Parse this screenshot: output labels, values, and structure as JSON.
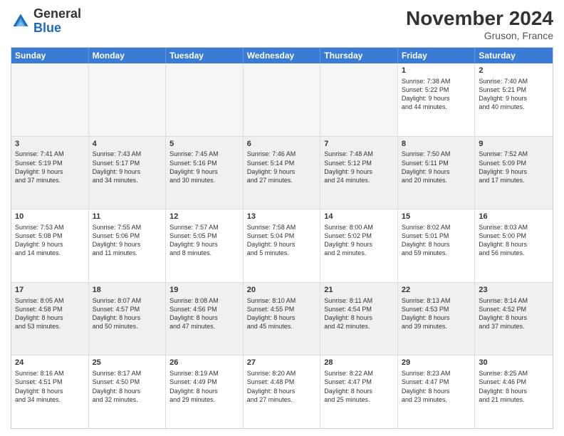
{
  "header": {
    "logo_line1": "General",
    "logo_line2": "Blue",
    "month_title": "November 2024",
    "location": "Gruson, France"
  },
  "weekdays": [
    "Sunday",
    "Monday",
    "Tuesday",
    "Wednesday",
    "Thursday",
    "Friday",
    "Saturday"
  ],
  "rows": [
    [
      {
        "day": "",
        "empty": true
      },
      {
        "day": "",
        "empty": true
      },
      {
        "day": "",
        "empty": true
      },
      {
        "day": "",
        "empty": true
      },
      {
        "day": "",
        "empty": true
      },
      {
        "day": "1",
        "lines": [
          "Sunrise: 7:38 AM",
          "Sunset: 5:22 PM",
          "Daylight: 9 hours",
          "and 44 minutes."
        ]
      },
      {
        "day": "2",
        "lines": [
          "Sunrise: 7:40 AM",
          "Sunset: 5:21 PM",
          "Daylight: 9 hours",
          "and 40 minutes."
        ]
      }
    ],
    [
      {
        "day": "3",
        "lines": [
          "Sunrise: 7:41 AM",
          "Sunset: 5:19 PM",
          "Daylight: 9 hours",
          "and 37 minutes."
        ]
      },
      {
        "day": "4",
        "lines": [
          "Sunrise: 7:43 AM",
          "Sunset: 5:17 PM",
          "Daylight: 9 hours",
          "and 34 minutes."
        ]
      },
      {
        "day": "5",
        "lines": [
          "Sunrise: 7:45 AM",
          "Sunset: 5:16 PM",
          "Daylight: 9 hours",
          "and 30 minutes."
        ]
      },
      {
        "day": "6",
        "lines": [
          "Sunrise: 7:46 AM",
          "Sunset: 5:14 PM",
          "Daylight: 9 hours",
          "and 27 minutes."
        ]
      },
      {
        "day": "7",
        "lines": [
          "Sunrise: 7:48 AM",
          "Sunset: 5:12 PM",
          "Daylight: 9 hours",
          "and 24 minutes."
        ]
      },
      {
        "day": "8",
        "lines": [
          "Sunrise: 7:50 AM",
          "Sunset: 5:11 PM",
          "Daylight: 9 hours",
          "and 20 minutes."
        ]
      },
      {
        "day": "9",
        "lines": [
          "Sunrise: 7:52 AM",
          "Sunset: 5:09 PM",
          "Daylight: 9 hours",
          "and 17 minutes."
        ]
      }
    ],
    [
      {
        "day": "10",
        "lines": [
          "Sunrise: 7:53 AM",
          "Sunset: 5:08 PM",
          "Daylight: 9 hours",
          "and 14 minutes."
        ]
      },
      {
        "day": "11",
        "lines": [
          "Sunrise: 7:55 AM",
          "Sunset: 5:06 PM",
          "Daylight: 9 hours",
          "and 11 minutes."
        ]
      },
      {
        "day": "12",
        "lines": [
          "Sunrise: 7:57 AM",
          "Sunset: 5:05 PM",
          "Daylight: 9 hours",
          "and 8 minutes."
        ]
      },
      {
        "day": "13",
        "lines": [
          "Sunrise: 7:58 AM",
          "Sunset: 5:04 PM",
          "Daylight: 9 hours",
          "and 5 minutes."
        ]
      },
      {
        "day": "14",
        "lines": [
          "Sunrise: 8:00 AM",
          "Sunset: 5:02 PM",
          "Daylight: 9 hours",
          "and 2 minutes."
        ]
      },
      {
        "day": "15",
        "lines": [
          "Sunrise: 8:02 AM",
          "Sunset: 5:01 PM",
          "Daylight: 8 hours",
          "and 59 minutes."
        ]
      },
      {
        "day": "16",
        "lines": [
          "Sunrise: 8:03 AM",
          "Sunset: 5:00 PM",
          "Daylight: 8 hours",
          "and 56 minutes."
        ]
      }
    ],
    [
      {
        "day": "17",
        "lines": [
          "Sunrise: 8:05 AM",
          "Sunset: 4:58 PM",
          "Daylight: 8 hours",
          "and 53 minutes."
        ]
      },
      {
        "day": "18",
        "lines": [
          "Sunrise: 8:07 AM",
          "Sunset: 4:57 PM",
          "Daylight: 8 hours",
          "and 50 minutes."
        ]
      },
      {
        "day": "19",
        "lines": [
          "Sunrise: 8:08 AM",
          "Sunset: 4:56 PM",
          "Daylight: 8 hours",
          "and 47 minutes."
        ]
      },
      {
        "day": "20",
        "lines": [
          "Sunrise: 8:10 AM",
          "Sunset: 4:55 PM",
          "Daylight: 8 hours",
          "and 45 minutes."
        ]
      },
      {
        "day": "21",
        "lines": [
          "Sunrise: 8:11 AM",
          "Sunset: 4:54 PM",
          "Daylight: 8 hours",
          "and 42 minutes."
        ]
      },
      {
        "day": "22",
        "lines": [
          "Sunrise: 8:13 AM",
          "Sunset: 4:53 PM",
          "Daylight: 8 hours",
          "and 39 minutes."
        ]
      },
      {
        "day": "23",
        "lines": [
          "Sunrise: 8:14 AM",
          "Sunset: 4:52 PM",
          "Daylight: 8 hours",
          "and 37 minutes."
        ]
      }
    ],
    [
      {
        "day": "24",
        "lines": [
          "Sunrise: 8:16 AM",
          "Sunset: 4:51 PM",
          "Daylight: 8 hours",
          "and 34 minutes."
        ]
      },
      {
        "day": "25",
        "lines": [
          "Sunrise: 8:17 AM",
          "Sunset: 4:50 PM",
          "Daylight: 8 hours",
          "and 32 minutes."
        ]
      },
      {
        "day": "26",
        "lines": [
          "Sunrise: 8:19 AM",
          "Sunset: 4:49 PM",
          "Daylight: 8 hours",
          "and 29 minutes."
        ]
      },
      {
        "day": "27",
        "lines": [
          "Sunrise: 8:20 AM",
          "Sunset: 4:48 PM",
          "Daylight: 8 hours",
          "and 27 minutes."
        ]
      },
      {
        "day": "28",
        "lines": [
          "Sunrise: 8:22 AM",
          "Sunset: 4:47 PM",
          "Daylight: 8 hours",
          "and 25 minutes."
        ]
      },
      {
        "day": "29",
        "lines": [
          "Sunrise: 8:23 AM",
          "Sunset: 4:47 PM",
          "Daylight: 8 hours",
          "and 23 minutes."
        ]
      },
      {
        "day": "30",
        "lines": [
          "Sunrise: 8:25 AM",
          "Sunset: 4:46 PM",
          "Daylight: 8 hours",
          "and 21 minutes."
        ]
      }
    ]
  ]
}
